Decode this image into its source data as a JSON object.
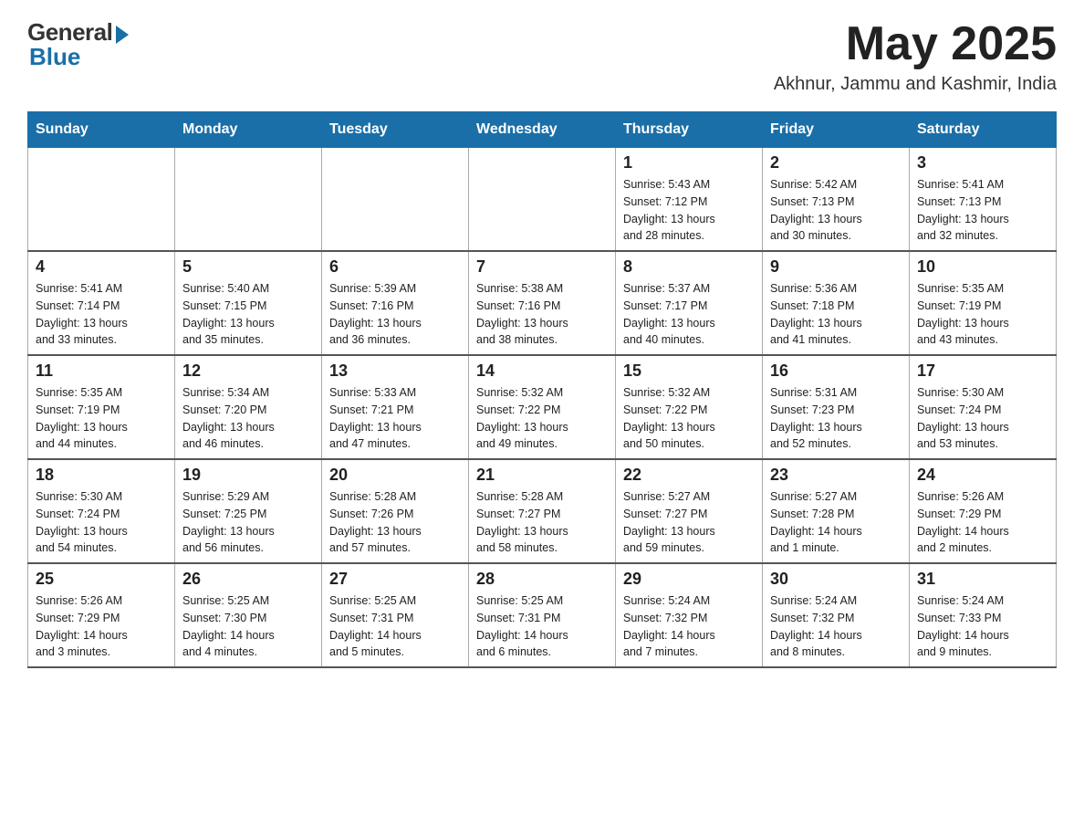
{
  "header": {
    "logo_general": "General",
    "logo_blue": "Blue",
    "month": "May 2025",
    "location": "Akhnur, Jammu and Kashmir, India"
  },
  "weekdays": [
    "Sunday",
    "Monday",
    "Tuesday",
    "Wednesday",
    "Thursday",
    "Friday",
    "Saturday"
  ],
  "weeks": [
    [
      {
        "day": "",
        "info": ""
      },
      {
        "day": "",
        "info": ""
      },
      {
        "day": "",
        "info": ""
      },
      {
        "day": "",
        "info": ""
      },
      {
        "day": "1",
        "info": "Sunrise: 5:43 AM\nSunset: 7:12 PM\nDaylight: 13 hours\nand 28 minutes."
      },
      {
        "day": "2",
        "info": "Sunrise: 5:42 AM\nSunset: 7:13 PM\nDaylight: 13 hours\nand 30 minutes."
      },
      {
        "day": "3",
        "info": "Sunrise: 5:41 AM\nSunset: 7:13 PM\nDaylight: 13 hours\nand 32 minutes."
      }
    ],
    [
      {
        "day": "4",
        "info": "Sunrise: 5:41 AM\nSunset: 7:14 PM\nDaylight: 13 hours\nand 33 minutes."
      },
      {
        "day": "5",
        "info": "Sunrise: 5:40 AM\nSunset: 7:15 PM\nDaylight: 13 hours\nand 35 minutes."
      },
      {
        "day": "6",
        "info": "Sunrise: 5:39 AM\nSunset: 7:16 PM\nDaylight: 13 hours\nand 36 minutes."
      },
      {
        "day": "7",
        "info": "Sunrise: 5:38 AM\nSunset: 7:16 PM\nDaylight: 13 hours\nand 38 minutes."
      },
      {
        "day": "8",
        "info": "Sunrise: 5:37 AM\nSunset: 7:17 PM\nDaylight: 13 hours\nand 40 minutes."
      },
      {
        "day": "9",
        "info": "Sunrise: 5:36 AM\nSunset: 7:18 PM\nDaylight: 13 hours\nand 41 minutes."
      },
      {
        "day": "10",
        "info": "Sunrise: 5:35 AM\nSunset: 7:19 PM\nDaylight: 13 hours\nand 43 minutes."
      }
    ],
    [
      {
        "day": "11",
        "info": "Sunrise: 5:35 AM\nSunset: 7:19 PM\nDaylight: 13 hours\nand 44 minutes."
      },
      {
        "day": "12",
        "info": "Sunrise: 5:34 AM\nSunset: 7:20 PM\nDaylight: 13 hours\nand 46 minutes."
      },
      {
        "day": "13",
        "info": "Sunrise: 5:33 AM\nSunset: 7:21 PM\nDaylight: 13 hours\nand 47 minutes."
      },
      {
        "day": "14",
        "info": "Sunrise: 5:32 AM\nSunset: 7:22 PM\nDaylight: 13 hours\nand 49 minutes."
      },
      {
        "day": "15",
        "info": "Sunrise: 5:32 AM\nSunset: 7:22 PM\nDaylight: 13 hours\nand 50 minutes."
      },
      {
        "day": "16",
        "info": "Sunrise: 5:31 AM\nSunset: 7:23 PM\nDaylight: 13 hours\nand 52 minutes."
      },
      {
        "day": "17",
        "info": "Sunrise: 5:30 AM\nSunset: 7:24 PM\nDaylight: 13 hours\nand 53 minutes."
      }
    ],
    [
      {
        "day": "18",
        "info": "Sunrise: 5:30 AM\nSunset: 7:24 PM\nDaylight: 13 hours\nand 54 minutes."
      },
      {
        "day": "19",
        "info": "Sunrise: 5:29 AM\nSunset: 7:25 PM\nDaylight: 13 hours\nand 56 minutes."
      },
      {
        "day": "20",
        "info": "Sunrise: 5:28 AM\nSunset: 7:26 PM\nDaylight: 13 hours\nand 57 minutes."
      },
      {
        "day": "21",
        "info": "Sunrise: 5:28 AM\nSunset: 7:27 PM\nDaylight: 13 hours\nand 58 minutes."
      },
      {
        "day": "22",
        "info": "Sunrise: 5:27 AM\nSunset: 7:27 PM\nDaylight: 13 hours\nand 59 minutes."
      },
      {
        "day": "23",
        "info": "Sunrise: 5:27 AM\nSunset: 7:28 PM\nDaylight: 14 hours\nand 1 minute."
      },
      {
        "day": "24",
        "info": "Sunrise: 5:26 AM\nSunset: 7:29 PM\nDaylight: 14 hours\nand 2 minutes."
      }
    ],
    [
      {
        "day": "25",
        "info": "Sunrise: 5:26 AM\nSunset: 7:29 PM\nDaylight: 14 hours\nand 3 minutes."
      },
      {
        "day": "26",
        "info": "Sunrise: 5:25 AM\nSunset: 7:30 PM\nDaylight: 14 hours\nand 4 minutes."
      },
      {
        "day": "27",
        "info": "Sunrise: 5:25 AM\nSunset: 7:31 PM\nDaylight: 14 hours\nand 5 minutes."
      },
      {
        "day": "28",
        "info": "Sunrise: 5:25 AM\nSunset: 7:31 PM\nDaylight: 14 hours\nand 6 minutes."
      },
      {
        "day": "29",
        "info": "Sunrise: 5:24 AM\nSunset: 7:32 PM\nDaylight: 14 hours\nand 7 minutes."
      },
      {
        "day": "30",
        "info": "Sunrise: 5:24 AM\nSunset: 7:32 PM\nDaylight: 14 hours\nand 8 minutes."
      },
      {
        "day": "31",
        "info": "Sunrise: 5:24 AM\nSunset: 7:33 PM\nDaylight: 14 hours\nand 9 minutes."
      }
    ]
  ]
}
